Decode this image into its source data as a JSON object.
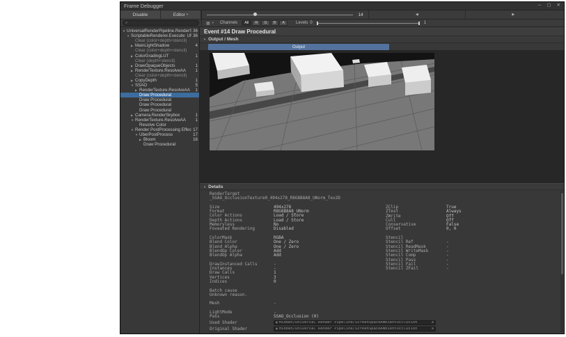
{
  "window": {
    "title": "Frame Debugger",
    "min_icon": "─",
    "max_icon": "▢",
    "close_icon": "✕"
  },
  "toolbar": {
    "disable_label": "Disable",
    "editor_label": "Editor",
    "editor_chevron": "▾",
    "frame_current": "14",
    "prev_icon": "◀",
    "next_icon": "▶"
  },
  "search": {
    "icon": "⌕"
  },
  "filterbar": {
    "rt_icon": "▦",
    "rt_chevron": "▾",
    "channels_label": "Channels",
    "channels": [
      "All",
      "R",
      "G",
      "B",
      "A"
    ],
    "active_channel": "All",
    "levels_label": "Levels",
    "levels_min": "0",
    "levels_max": "1"
  },
  "event": {
    "title": "Event #14 Draw Procedural",
    "foldout_open_icon": "▼",
    "output_mesh_label": "Output / Mesh",
    "output_tab_label": "Output",
    "details_label": "Details"
  },
  "tree": {
    "items": [
      {
        "label": "UniversalRenderPipeline.RenderSingleCamera(int:",
        "count": "36",
        "level": 0,
        "arrow": "down",
        "style": "normal"
      },
      {
        "label": "ScriptableRenderer.Execute: URP-HighFidelity",
        "count": "36",
        "level": 1,
        "arrow": "down",
        "style": "normal"
      },
      {
        "label": "Clear (color+depth+stencil)",
        "count": "",
        "level": 2,
        "arrow": "none",
        "style": "dim"
      },
      {
        "label": "MainLightShadow",
        "count": "4",
        "level": 2,
        "arrow": "right",
        "style": "normal"
      },
      {
        "label": "Clear (color+depth+stencil)",
        "count": "",
        "level": 2,
        "arrow": "none",
        "style": "dim"
      },
      {
        "label": "ColorGradingLUT",
        "count": "1",
        "level": 2,
        "arrow": "right",
        "style": "normal"
      },
      {
        "label": "Clear (depth+stencil)",
        "count": "",
        "level": 2,
        "arrow": "none",
        "style": "dim"
      },
      {
        "label": "DrawOpaqueObjects",
        "count": "1",
        "level": 2,
        "arrow": "right",
        "style": "normal"
      },
      {
        "label": "RenderTexture.ResolveAA",
        "count": "1",
        "level": 2,
        "arrow": "right",
        "style": "normal"
      },
      {
        "label": "Clear (color+depth+stencil)",
        "count": "",
        "level": 2,
        "arrow": "none",
        "style": "dim"
      },
      {
        "label": "CopyDepth",
        "count": "1",
        "level": 2,
        "arrow": "right",
        "style": "normal"
      },
      {
        "label": "SSAO",
        "count": "5",
        "level": 2,
        "arrow": "down",
        "style": "normal"
      },
      {
        "label": "RenderTexture.ResolveAA",
        "count": "1",
        "level": 3,
        "arrow": "right",
        "style": "normal"
      },
      {
        "label": "Draw Procedural",
        "count": "",
        "level": 3,
        "arrow": "none",
        "style": "selected"
      },
      {
        "label": "Draw Procedural",
        "count": "",
        "level": 3,
        "arrow": "none",
        "style": "normal"
      },
      {
        "label": "Draw Procedural",
        "count": "",
        "level": 3,
        "arrow": "none",
        "style": "normal"
      },
      {
        "label": "Draw Procedural",
        "count": "",
        "level": 3,
        "arrow": "none",
        "style": "normal"
      },
      {
        "label": "Camera.RenderSkybox",
        "count": "1",
        "level": 2,
        "arrow": "right",
        "style": "normal"
      },
      {
        "label": "RenderTexture.ResolveAA",
        "count": "1",
        "level": 2,
        "arrow": "down",
        "style": "normal"
      },
      {
        "label": "Resolve Color",
        "count": "",
        "level": 3,
        "arrow": "none",
        "style": "normal"
      },
      {
        "label": "Render PostProcessing Effects",
        "count": "17",
        "level": 2,
        "arrow": "down",
        "style": "normal"
      },
      {
        "label": "UberPostProcess",
        "count": "17",
        "level": 3,
        "arrow": "down",
        "style": "normal"
      },
      {
        "label": "Bloom",
        "count": "16",
        "level": 4,
        "arrow": "right",
        "style": "normal"
      },
      {
        "label": "Draw Procedural",
        "count": "",
        "level": 4,
        "arrow": "none",
        "style": "normal"
      }
    ]
  },
  "details": {
    "shader_value": "Hidden/Universal Render Pipeline/ScreenSpaceAmbientOcclusion",
    "object_picker_icon": "⊙",
    "shader_icon": "▣",
    "left_rows": [
      {
        "type": "label",
        "label": "RenderTarget"
      },
      {
        "type": "full",
        "label": "_SSAO_OcclusionTexture0_494x278_R8G8B8A8_UNorm_Tex2D"
      },
      {
        "type": "blank"
      },
      {
        "label": "Size",
        "value": "494x278"
      },
      {
        "label": "Format",
        "value": "R8G8B8A8_UNorm"
      },
      {
        "label": "Color Actions",
        "value": "Load / Store"
      },
      {
        "label": "Depth Actions",
        "value": "Load / Store"
      },
      {
        "label": "Memoryless",
        "value": "No"
      },
      {
        "label": "Foveated Rendering",
        "value": "Disabled"
      },
      {
        "type": "blank"
      },
      {
        "label": "ColorMask",
        "value": "RGBA"
      },
      {
        "label": "Blend Color",
        "value": "One / Zero"
      },
      {
        "label": "Blend Alpha",
        "value": "One / Zero"
      },
      {
        "label": "BlendOp Color",
        "value": "Add"
      },
      {
        "label": "BlendOp Alpha",
        "value": "Add"
      },
      {
        "type": "blank"
      },
      {
        "label": "DrawInstanced Calls",
        "value": "-"
      },
      {
        "label": "Instances",
        "value": "-"
      },
      {
        "label": "Draw Calls",
        "value": "1"
      },
      {
        "label": "Vertices",
        "value": "3"
      },
      {
        "label": "Indices",
        "value": "0"
      },
      {
        "type": "blank"
      },
      {
        "type": "label",
        "label": "Batch cause"
      },
      {
        "type": "label",
        "label": "Unknown reason."
      },
      {
        "type": "blank"
      },
      {
        "label": "Mesh",
        "value": "-"
      },
      {
        "type": "blank"
      },
      {
        "label": "LightMode",
        "value": "-"
      },
      {
        "label": "Pass",
        "value": "SSAO_Occlusion (0)"
      },
      {
        "type": "shader",
        "label": "Used Shader"
      },
      {
        "type": "shader",
        "label": "Original Shader"
      }
    ],
    "right_rows": [
      {
        "label": "ZClip",
        "value": "True"
      },
      {
        "label": "ZTest",
        "value": "Always"
      },
      {
        "label": "ZWrite",
        "value": "Off"
      },
      {
        "label": "Cull",
        "value": "Off"
      },
      {
        "label": "Conservative",
        "value": "False"
      },
      {
        "label": "Offset",
        "value": "0, 0"
      },
      {
        "type": "blank"
      },
      {
        "label": "Stencil",
        "value": ""
      },
      {
        "label": "Stencil Ref",
        "value": "-"
      },
      {
        "label": "Stencil ReadMask",
        "value": "-"
      },
      {
        "label": "Stencil WriteMask",
        "value": "-"
      },
      {
        "label": "Stencil Comp",
        "value": "-"
      },
      {
        "label": "Stencil Pass",
        "value": "-"
      },
      {
        "label": "Stencil Fail",
        "value": "-"
      },
      {
        "label": "Stencil ZFail",
        "value": "-"
      }
    ]
  },
  "colors": {
    "selection_blue": "#3d6c9e",
    "tab_blue": "#53739e",
    "window_bg": "#383838",
    "viewport_bg": "#272727"
  }
}
